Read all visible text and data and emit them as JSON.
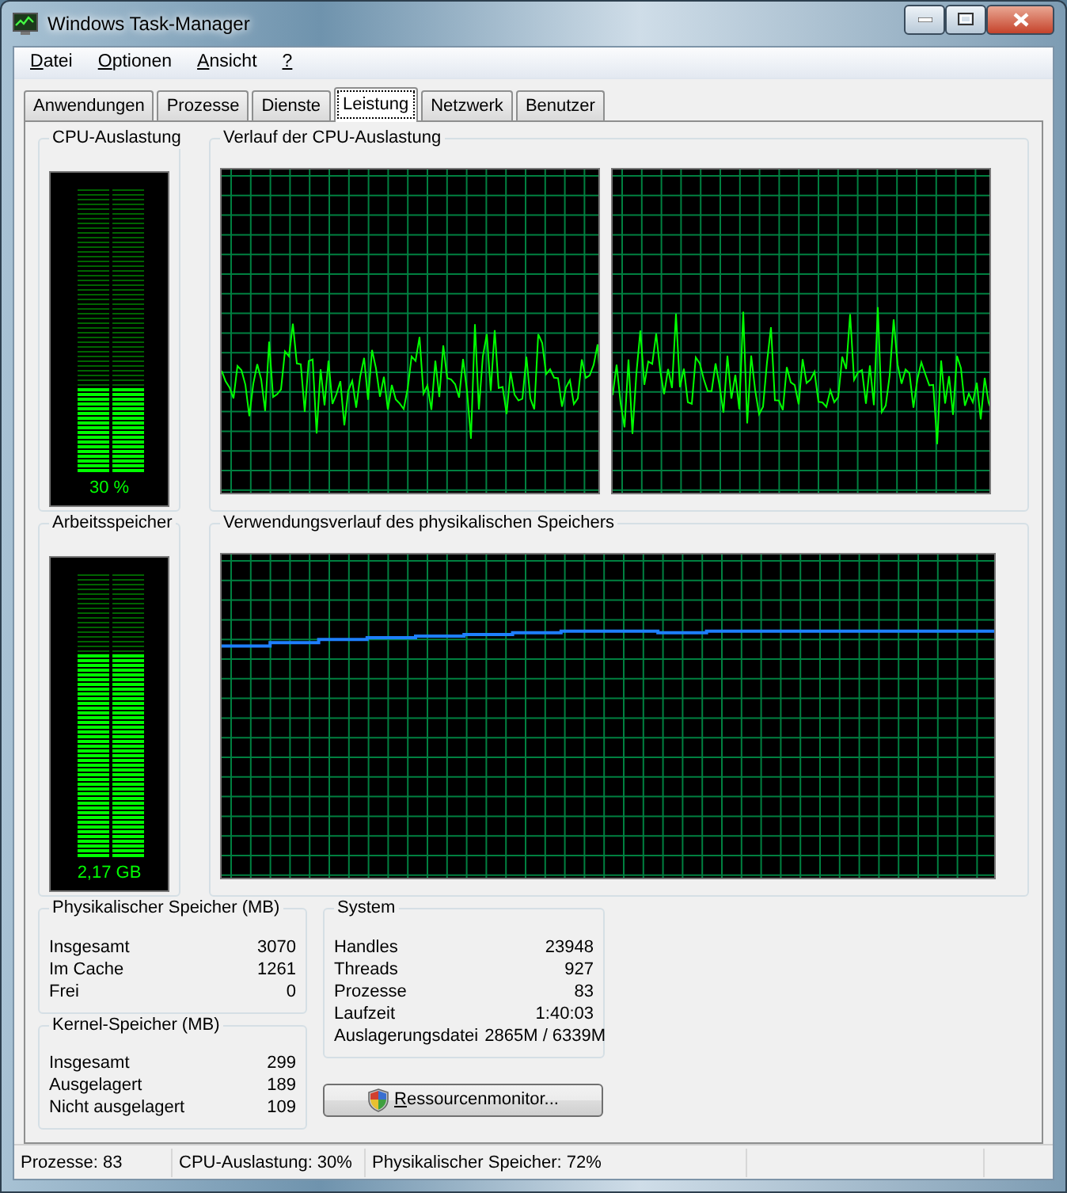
{
  "window": {
    "title": "Windows Task-Manager"
  },
  "menu": [
    "Datei",
    "Optionen",
    "Ansicht",
    "?"
  ],
  "tabs": [
    {
      "label": "Anwendungen",
      "selected": false
    },
    {
      "label": "Prozesse",
      "selected": false
    },
    {
      "label": "Dienste",
      "selected": false
    },
    {
      "label": "Leistung",
      "selected": true
    },
    {
      "label": "Netzwerk",
      "selected": false
    },
    {
      "label": "Benutzer",
      "selected": false
    }
  ],
  "cpu_usage": {
    "title": "CPU-Auslastung",
    "level": 0.3,
    "reading": "30 %"
  },
  "cpu_history": {
    "title": "Verlauf der CPU-Auslastung"
  },
  "memory": {
    "title": "Arbeitsspeicher",
    "level": 0.72,
    "reading": "2,17 GB"
  },
  "memory_history": {
    "title": "Verwendungsverlauf des physikalischen Speichers"
  },
  "physical_memory": {
    "title": "Physikalischer Speicher (MB)",
    "rows": [
      {
        "label": "Insgesamt",
        "value": "3070"
      },
      {
        "label": "Im Cache",
        "value": "1261"
      },
      {
        "label": "Frei",
        "value": "0"
      }
    ]
  },
  "kernel_memory": {
    "title": "Kernel-Speicher (MB)",
    "rows": [
      {
        "label": "Insgesamt",
        "value": "299"
      },
      {
        "label": "Ausgelagert",
        "value": "189"
      },
      {
        "label": "Nicht ausgelagert",
        "value": "109"
      }
    ]
  },
  "system": {
    "title": "System",
    "rows": [
      {
        "label": "Handles",
        "value": "23948"
      },
      {
        "label": "Threads",
        "value": "927"
      },
      {
        "label": "Prozesse",
        "value": "83"
      },
      {
        "label": "Laufzeit",
        "value": "1:40:03"
      },
      {
        "label": "Auslagerungsdatei",
        "value": "2865M / 6339M"
      }
    ]
  },
  "resource_monitor_button": "Ressourcenmonitor...",
  "status_bar": [
    "Prozesse: 83",
    "CPU-Auslastung: 30%",
    "Physikalischer Speicher: 72%"
  ]
}
